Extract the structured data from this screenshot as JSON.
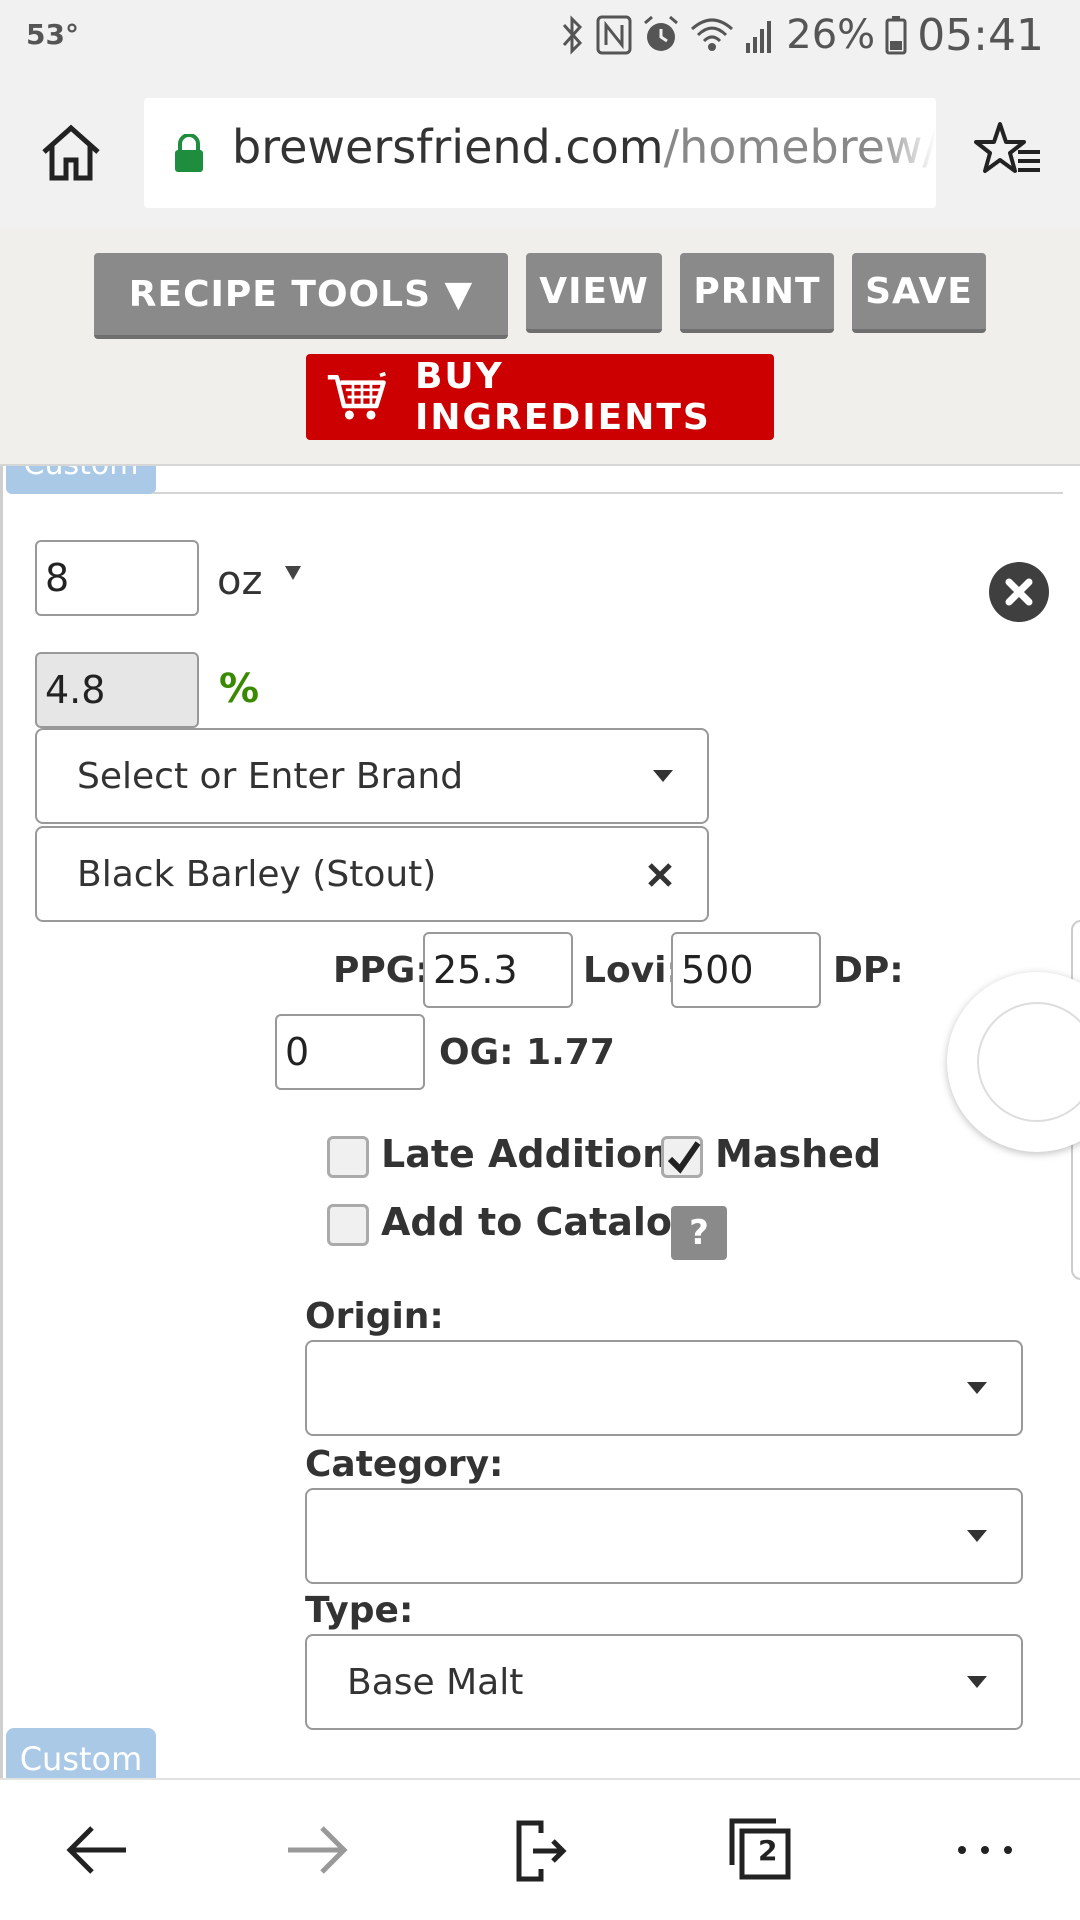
{
  "status_bar": {
    "temperature": "53°",
    "battery": "26%",
    "time": "05:41"
  },
  "browser": {
    "url_host": "brewersfriend.com",
    "url_path": "/homebrew/re"
  },
  "toolbar": {
    "recipe_tools_label": "RECIPE TOOLS ▼",
    "view_label": "VIEW",
    "print_label": "PRINT",
    "save_label": "SAVE",
    "buy_label": "BUY INGREDIENTS"
  },
  "tabs": {
    "custom_label": "Custom"
  },
  "fermentable": {
    "amount": "8",
    "unit": "oz",
    "percent_value": "4.8",
    "percent_sign": "%",
    "brand_placeholder": "Select or Enter Brand",
    "name": "Black Barley (Stout)",
    "ppg_label": "PPG:",
    "ppg_value": "25.3",
    "lovi_label": "Lovi:",
    "lovi_value": "500",
    "dp_label": "DP:",
    "dp_value": "0",
    "og_label": "OG: 1.77",
    "late_addition_label": "Late Addition",
    "late_addition_checked": false,
    "mashed_label": "Mashed",
    "mashed_checked": true,
    "add_to_catalog_label": "Add to Catalog",
    "add_to_catalog_checked": false,
    "help_label": "?",
    "origin_label": "Origin:",
    "origin_value": "",
    "category_label": "Category:",
    "category_value": "",
    "type_label": "Type:",
    "type_value": "Base Malt"
  },
  "bottom_nav": {
    "tab_count": "2"
  },
  "colors": {
    "buy_button": "#cc0000",
    "toolbar_button": "#8a8a8a",
    "percent_green": "#3a8a00",
    "custom_tab": "#a9c9e6",
    "lock_green": "#1e8e3e"
  }
}
